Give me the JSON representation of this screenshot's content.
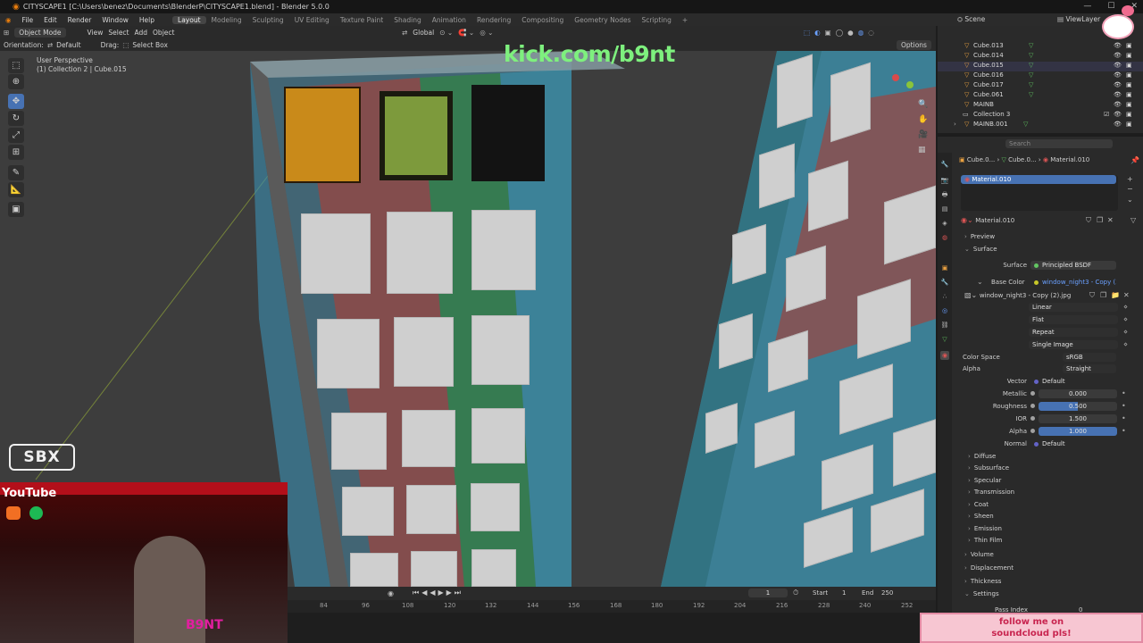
{
  "titlebar": {
    "title": "CITYSCAPE1 [C:\\Users\\benez\\Documents\\BlenderP\\CITYSCAPE1.blend] - Blender 5.0.0",
    "minimize": "—",
    "maximize": "☐",
    "close": "✕"
  },
  "menu": {
    "items": [
      "File",
      "Edit",
      "Render",
      "Window",
      "Help"
    ],
    "workspaces": [
      "Layout",
      "Modeling",
      "Sculpting",
      "UV Editing",
      "Texture Paint",
      "Shading",
      "Animation",
      "Rendering",
      "Compositing",
      "Geometry Nodes",
      "Scripting"
    ],
    "active_workspace": "Layout",
    "add_tab": "+",
    "scene": "Scene",
    "view_layer": "ViewLayer"
  },
  "header": {
    "orientation_label": "Orientation:",
    "orientation_value": "Default",
    "drag_label": "Drag:",
    "drag_value": "Select Box",
    "mode": "Object Mode",
    "view_menu": [
      "View",
      "Select",
      "Add",
      "Object"
    ],
    "transform_orientation": "Global",
    "options": "Options"
  },
  "viewport": {
    "perspective": "User Perspective",
    "collection_info": "(1) Collection 2 | Cube.015"
  },
  "outliner": {
    "rows": [
      {
        "name": "Cube.013",
        "type": "object"
      },
      {
        "name": "Cube.014",
        "type": "object"
      },
      {
        "name": "Cube.015",
        "type": "object"
      },
      {
        "name": "Cube.016",
        "type": "object"
      },
      {
        "name": "Cube.017",
        "type": "object"
      },
      {
        "name": "Cube.061",
        "type": "object"
      },
      {
        "name": "MAINB",
        "type": "object"
      },
      {
        "name": "Collection 3",
        "type": "collection"
      },
      {
        "name": "MAINB.001",
        "type": "object"
      }
    ],
    "search_placeholder": "Search"
  },
  "properties": {
    "search_placeholder": "Search",
    "breadcrumb": [
      "Cube.0...",
      "Cube.0...",
      "Material.010"
    ],
    "slot_name": "Material.010",
    "material_name": "Material.010",
    "sections": {
      "preview": "Preview",
      "surface": "Surface",
      "volume": "Volume",
      "displacement": "Displacement",
      "thickness": "Thickness",
      "settings": "Settings"
    },
    "surface_label": "Surface",
    "surface_value": "Principled BSDF",
    "base_color_label": "Base Color",
    "base_color_value": "window_night3 - Copy (2...",
    "image_name": "window_night3 - Copy (2).jpg",
    "interpolation": "Linear",
    "projection": "Flat",
    "extension": "Repeat",
    "source": "Single Image",
    "color_space_label": "Color Space",
    "color_space_value": "sRGB",
    "alpha_label": "Alpha",
    "alpha_value": "Straight",
    "vector_label": "Vector",
    "vector_value": "Default",
    "metallic_label": "Metallic",
    "metallic_value": "0.000",
    "roughness_label": "Roughness",
    "roughness_value": "0.500",
    "ior_label": "IOR",
    "ior_value": "1.500",
    "alpha2_label": "Alpha",
    "alpha2_value": "1.000",
    "normal_label": "Normal",
    "normal_value": "Default",
    "subpanels": [
      "Diffuse",
      "Subsurface",
      "Specular",
      "Transmission",
      "Coat",
      "Sheen",
      "Emission",
      "Thin Film"
    ],
    "pass_index_label": "Pass Index",
    "pass_index_value": "0"
  },
  "timeline": {
    "current_frame": "1",
    "start_label": "Start",
    "start_value": "1",
    "end_label": "End",
    "end_value": "250",
    "ticks": [
      "84",
      "96",
      "108",
      "120",
      "132",
      "144",
      "156",
      "168",
      "180",
      "192",
      "204",
      "216",
      "228",
      "240",
      "252"
    ]
  },
  "overlay": {
    "kick": "kick.com/b9nt",
    "youtube": "YouTube",
    "sbx": "SBX",
    "soundcloud_banner_1": "follow me on",
    "soundcloud_banner_2": "soundcloud pls!",
    "b9nt_logo": "B9NT"
  },
  "colors": {
    "accent": "#4772b3",
    "viewport_bg": "#3d3d3d",
    "panel_bg": "#2a2a2a",
    "kick_green": "#7ef07e",
    "banner_pink": "#f7c6d2"
  }
}
